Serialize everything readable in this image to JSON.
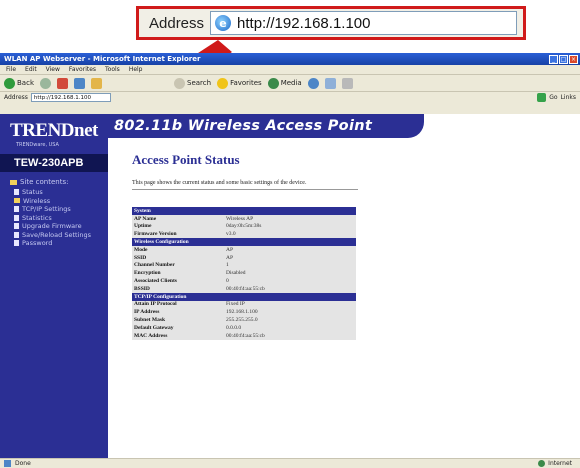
{
  "callout": {
    "label": "Address",
    "url": "http://192.168.1.100"
  },
  "window": {
    "title": "WLAN AP Webserver - Microsoft Internet Explorer",
    "controls": [
      "_",
      "□",
      "×"
    ]
  },
  "menu": [
    "File",
    "Edit",
    "View",
    "Favorites",
    "Tools",
    "Help"
  ],
  "toolbar": {
    "back": "Back",
    "search": "Search",
    "favorites": "Favorites",
    "media": "Media"
  },
  "addressbar": {
    "label": "Address",
    "url": "http://192.168.1.100",
    "go": "Go",
    "links": "Links"
  },
  "sidebar": {
    "logo": "TRENDnet",
    "logo_sub": "TRENDware, USA",
    "model": "TEW-230APB",
    "nav_head": "Site contents:",
    "items": [
      "Status",
      "Wireless",
      "TCP/IP Settings",
      "Statistics",
      "Upgrade Firmware",
      "Save/Reload Settings",
      "Password"
    ]
  },
  "banner": "802.11b Wireless Access Point",
  "content": {
    "title": "Access Point Status",
    "intro": "This page shows the current status and some basic settings of the device."
  },
  "status_table": {
    "sections": [
      {
        "header": "System",
        "rows": [
          {
            "key": "AP Name",
            "value": "Wireless AP"
          },
          {
            "key": "Uptime",
            "value": "0day:0h:5m:38s"
          },
          {
            "key": "Firmware Version",
            "value": "v3.0"
          }
        ]
      },
      {
        "header": "Wireless Configuration",
        "rows": [
          {
            "key": "Mode",
            "value": "AP"
          },
          {
            "key": "SSID",
            "value": "AP"
          },
          {
            "key": "Channel Number",
            "value": "1"
          },
          {
            "key": "Encryption",
            "value": "Disabled"
          },
          {
            "key": "Associated Clients",
            "value": "0"
          },
          {
            "key": "BSSID",
            "value": "00:40:f4:aa:55:cb"
          }
        ]
      },
      {
        "header": "TCP/IP Configuration",
        "rows": [
          {
            "key": "Attain IP Protocol",
            "value": "Fixed IP"
          },
          {
            "key": "IP Address",
            "value": "192.168.1.100"
          },
          {
            "key": "Subnet Mask",
            "value": "255.255.255.0"
          },
          {
            "key": "Default Gateway",
            "value": "0.0.0.0"
          },
          {
            "key": "MAC Address",
            "value": "00:40:f4:aa:55:cb"
          }
        ]
      }
    ]
  },
  "statusbar": {
    "left": "Done",
    "zone": "Internet"
  },
  "colors": {
    "accent": "#2b2f94",
    "callout_border": "#d01a1a"
  }
}
